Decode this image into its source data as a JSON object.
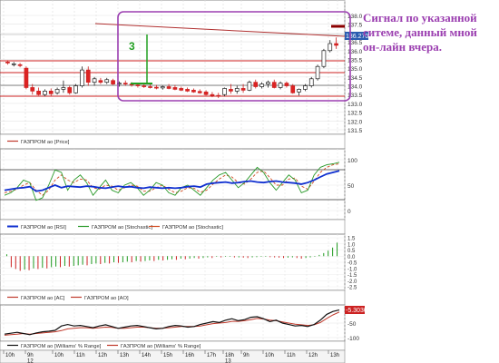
{
  "panels": {
    "price": {
      "y_ticks": [
        "138.0",
        "137.5",
        "137.0",
        "136.5",
        "136.0",
        "135.5",
        "135.0",
        "134.5",
        "134.0",
        "133.5",
        "133.0",
        "132.5",
        "132.0",
        "131.5"
      ],
      "last_price_badge": "136.2701",
      "legend": [
        {
          "label": "ГАЗПРОМ ao [Price]",
          "color": "#c0392b"
        }
      ],
      "signal_label": "3",
      "candles": [
        {
          "o": 135.35,
          "h": 135.45,
          "l": 135.2,
          "c": 135.3
        },
        {
          "o": 135.2,
          "h": 135.35,
          "l": 135.1,
          "c": 135.25
        },
        {
          "o": 135.2,
          "h": 135.3,
          "l": 135.05,
          "c": 135.15
        },
        {
          "o": 135.0,
          "h": 135.1,
          "l": 133.8,
          "c": 133.9
        },
        {
          "o": 133.9,
          "h": 134.1,
          "l": 133.5,
          "c": 133.7
        },
        {
          "o": 133.7,
          "h": 133.9,
          "l": 133.45,
          "c": 133.5
        },
        {
          "o": 133.5,
          "h": 133.8,
          "l": 133.4,
          "c": 133.7
        },
        {
          "o": 133.7,
          "h": 133.85,
          "l": 133.4,
          "c": 133.55
        },
        {
          "o": 133.6,
          "h": 133.9,
          "l": 133.5,
          "c": 133.8
        },
        {
          "o": 133.8,
          "h": 134.3,
          "l": 133.6,
          "c": 133.9
        },
        {
          "o": 133.9,
          "h": 134.0,
          "l": 133.5,
          "c": 133.6
        },
        {
          "o": 133.6,
          "h": 134.1,
          "l": 133.55,
          "c": 134.0
        },
        {
          "o": 134.0,
          "h": 135.1,
          "l": 133.9,
          "c": 134.9
        },
        {
          "o": 134.9,
          "h": 135.1,
          "l": 134.0,
          "c": 134.2
        },
        {
          "o": 134.2,
          "h": 134.5,
          "l": 134.0,
          "c": 134.4
        },
        {
          "o": 134.3,
          "h": 134.45,
          "l": 134.1,
          "c": 134.2
        },
        {
          "o": 134.2,
          "h": 134.45,
          "l": 134.1,
          "c": 134.35
        },
        {
          "o": 134.3,
          "h": 134.4,
          "l": 134.05,
          "c": 134.1
        },
        {
          "o": 134.1,
          "h": 134.25,
          "l": 133.95,
          "c": 134.15
        },
        {
          "o": 134.15,
          "h": 134.3,
          "l": 134.0,
          "c": 134.1
        },
        {
          "o": 134.1,
          "h": 134.2,
          "l": 133.95,
          "c": 134.05
        },
        {
          "o": 134.05,
          "h": 134.15,
          "l": 133.9,
          "c": 134.0
        },
        {
          "o": 134.0,
          "h": 134.12,
          "l": 133.88,
          "c": 133.95
        },
        {
          "o": 133.95,
          "h": 134.1,
          "l": 133.85,
          "c": 133.92
        },
        {
          "o": 133.92,
          "h": 134.05,
          "l": 133.8,
          "c": 133.88
        },
        {
          "o": 133.88,
          "h": 134.02,
          "l": 133.78,
          "c": 133.95
        },
        {
          "o": 133.95,
          "h": 134.1,
          "l": 133.8,
          "c": 133.85
        },
        {
          "o": 133.9,
          "h": 134.05,
          "l": 133.75,
          "c": 133.8
        },
        {
          "o": 133.85,
          "h": 133.95,
          "l": 133.7,
          "c": 133.75
        },
        {
          "o": 133.8,
          "h": 133.9,
          "l": 133.65,
          "c": 133.7
        },
        {
          "o": 133.75,
          "h": 133.85,
          "l": 133.6,
          "c": 133.65
        },
        {
          "o": 133.68,
          "h": 133.8,
          "l": 133.55,
          "c": 133.6
        },
        {
          "o": 133.65,
          "h": 133.75,
          "l": 133.45,
          "c": 133.5
        },
        {
          "o": 133.5,
          "h": 133.65,
          "l": 133.35,
          "c": 133.45
        },
        {
          "o": 133.45,
          "h": 133.6,
          "l": 133.3,
          "c": 133.4
        },
        {
          "o": 133.5,
          "h": 133.9,
          "l": 133.4,
          "c": 133.85
        },
        {
          "o": 133.8,
          "h": 134.1,
          "l": 133.55,
          "c": 133.7
        },
        {
          "o": 133.7,
          "h": 134.0,
          "l": 133.55,
          "c": 133.85
        },
        {
          "o": 133.85,
          "h": 134.1,
          "l": 133.6,
          "c": 133.75
        },
        {
          "o": 133.75,
          "h": 134.3,
          "l": 133.7,
          "c": 134.2
        },
        {
          "o": 134.2,
          "h": 134.35,
          "l": 133.85,
          "c": 133.95
        },
        {
          "o": 133.95,
          "h": 134.2,
          "l": 133.85,
          "c": 134.1
        },
        {
          "o": 134.1,
          "h": 134.3,
          "l": 133.9,
          "c": 134.2
        },
        {
          "o": 134.2,
          "h": 134.35,
          "l": 133.85,
          "c": 133.9
        },
        {
          "o": 133.9,
          "h": 134.25,
          "l": 133.8,
          "c": 134.15
        },
        {
          "o": 134.15,
          "h": 134.25,
          "l": 133.9,
          "c": 134.0
        },
        {
          "o": 134.0,
          "h": 134.1,
          "l": 133.55,
          "c": 133.6
        },
        {
          "o": 133.65,
          "h": 133.85,
          "l": 133.45,
          "c": 133.8
        },
        {
          "o": 133.8,
          "h": 134.1,
          "l": 133.7,
          "c": 134.0
        },
        {
          "o": 134.0,
          "h": 134.5,
          "l": 133.9,
          "c": 134.4
        },
        {
          "o": 134.4,
          "h": 135.2,
          "l": 134.3,
          "c": 135.1
        },
        {
          "o": 135.1,
          "h": 136.1,
          "l": 135.0,
          "c": 136.0
        },
        {
          "o": 136.0,
          "h": 136.6,
          "l": 135.9,
          "c": 136.4
        },
        {
          "o": 136.4,
          "h": 136.75,
          "l": 136.1,
          "c": 136.3
        }
      ]
    },
    "oscillator": {
      "y_ticks": [
        "100",
        "50",
        "0"
      ],
      "legend": [
        {
          "label": "ГАЗПРОМ ao [RSI]",
          "color": "#1030d0"
        },
        {
          "label": "ГАЗПРОМ ao [Stochastic]",
          "color": "#2a9a2a"
        },
        {
          "label": "ГАЗПРОМ ao [Stochastic]",
          "color": "#d04a20"
        }
      ]
    },
    "accelerator": {
      "y_ticks": [
        "1.5",
        "1.0",
        "0.5",
        "0.0",
        "-0.5",
        "-1.0",
        "-1.5",
        "-2.0",
        "-2.5"
      ],
      "legend": [
        {
          "label": "ГАЗПРОМ ao [AC]",
          "color": "#c0392b"
        },
        {
          "label": "ГАЗПРОМ ao [AO]",
          "color": "#c0392b"
        }
      ],
      "ac": [
        0.15,
        -0.9,
        -1.05,
        -1.2,
        -1.1,
        -1.15,
        -1.0,
        -1.05,
        -0.95,
        -1.0,
        -0.9,
        -0.85,
        -0.9,
        -0.8,
        -0.85,
        -0.8,
        -0.75,
        -0.7,
        -0.75,
        -0.65,
        -0.6,
        -0.65,
        -0.55,
        -0.6,
        -0.5,
        -0.55,
        -0.5,
        -0.45,
        -0.5,
        -0.4,
        -0.45,
        -0.4,
        -0.35,
        -0.4,
        -0.3,
        -0.35,
        -0.3,
        -0.25,
        -0.3,
        -0.2,
        -0.25,
        -0.2,
        -0.15,
        -0.2,
        -0.15,
        -0.1,
        -0.15,
        -0.05,
        -0.1,
        -0.05,
        -0.05,
        -0.1,
        -0.1,
        -0.12,
        -0.15,
        -0.1,
        -0.08,
        -0.05,
        -0.05,
        -0.08,
        -0.1,
        -0.12,
        -0.15,
        -0.12,
        -0.1,
        -0.15,
        -0.2,
        -0.15,
        -0.1,
        -0.05,
        0.1,
        0.25,
        0.45,
        0.7,
        1.1
      ]
    },
    "williams": {
      "y_ticks": [
        "-50",
        "-100"
      ],
      "last_value_badge": "-5.3030",
      "legend": [
        {
          "label": "ГАЗПРОМ ao [Williams' % Range]",
          "color": "#111111"
        },
        {
          "label": "ГАЗПРОМ ao [Williams' % Range]",
          "color": "#c0392b"
        }
      ]
    }
  },
  "time_axis": {
    "labels": [
      "10h",
      "9h",
      "10h",
      "11h",
      "12h",
      "13h",
      "14h",
      "15h",
      "16h",
      "17h",
      "18h",
      "9h",
      "10h",
      "11h",
      "12h",
      "13h",
      "14h",
      "15h"
    ],
    "date_labels": [
      "12",
      "13"
    ]
  },
  "annotation": {
    "text": "Сигнал по указанной ситеме, данный мной он-лайн вчера."
  },
  "colors": {
    "annotation": "#9b3fb0",
    "signal": "#22a022",
    "level_lines": "#cc2222",
    "trend_line": "#b03030"
  }
}
